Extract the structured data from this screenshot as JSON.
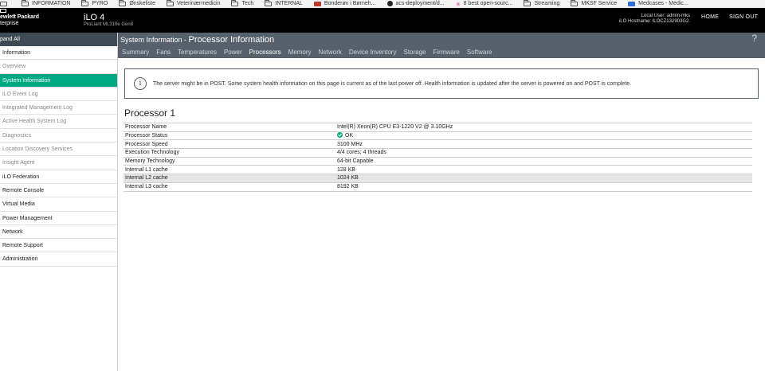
{
  "bookmarks": [
    {
      "label": "",
      "icon": "monitor-icon"
    },
    {
      "label": "INFORMATION",
      "icon": "folder-icon"
    },
    {
      "label": "PYRO",
      "icon": "folder-icon"
    },
    {
      "label": "Ønskeliste",
      "icon": "folder-icon"
    },
    {
      "label": "Veterinærmedicin",
      "icon": "folder-icon"
    },
    {
      "label": "Tech",
      "icon": "folder-icon"
    },
    {
      "label": "INTERNAL",
      "icon": "folder-icon"
    },
    {
      "label": "Bonderøv i Børneh...",
      "icon": "red-site-icon"
    },
    {
      "label": "acs-deployment/d...",
      "icon": "github-icon"
    },
    {
      "label": "8 best open-sourc...",
      "icon": "pink-site-icon"
    },
    {
      "label": "Streaming",
      "icon": "folder-icon"
    },
    {
      "label": "MKSF Service",
      "icon": "folder-icon"
    },
    {
      "label": "Medcases - Medic...",
      "icon": "blue-site-icon"
    }
  ],
  "header": {
    "brand_line1": "ewlett Packard",
    "brand_line2": "terprise",
    "product": "iLO 4",
    "model": "ProLiant ML310e Gen8",
    "local_user": "Local User: admin-mks",
    "hostname": "iLO Hostname: ILOCZ132903G2.",
    "home_label": "HOME",
    "signout_label": "SIGN OUT"
  },
  "sidebar": {
    "expand_label": "pand All",
    "items": [
      {
        "label": "Information",
        "type": "section"
      },
      {
        "label": "Overview",
        "type": "sub"
      },
      {
        "label": "System Information",
        "type": "active"
      },
      {
        "label": "iLO Event Log",
        "type": "sub"
      },
      {
        "label": "Integrated Management Log",
        "type": "sub"
      },
      {
        "label": "Active Health System Log",
        "type": "sub"
      },
      {
        "label": "Diagnostics",
        "type": "sub"
      },
      {
        "label": "Location Discovery Services",
        "type": "sub"
      },
      {
        "label": "Insight Agent",
        "type": "sub"
      },
      {
        "label": "iLO Federation",
        "type": "section"
      },
      {
        "label": "Remote Console",
        "type": "section"
      },
      {
        "label": "Virtual Media",
        "type": "section"
      },
      {
        "label": "Power Management",
        "type": "section"
      },
      {
        "label": "Network",
        "type": "section"
      },
      {
        "label": "Remote Support",
        "type": "section"
      },
      {
        "label": "Administration",
        "type": "section"
      }
    ]
  },
  "main": {
    "breadcrumb_prefix": "System Information - ",
    "breadcrumb_page": "Processor Information",
    "help_icon": "?",
    "tabs": [
      "Summary",
      "Fans",
      "Temperatures",
      "Power",
      "Processors",
      "Memory",
      "Network",
      "Device Inventory",
      "Storage",
      "Firmware",
      "Software"
    ],
    "active_tab": "Processors",
    "alert_text": "The server might be in POST. Some system health information on this page is current as of the last power off. Health information is updated after the server is powered on and POST is complete.",
    "processor_title": "Processor 1",
    "rows": [
      {
        "label": "Processor Name",
        "value": "Intel(R) Xeon(R) CPU E3-1220 V2 @ 3.10GHz"
      },
      {
        "label": "Processor Status",
        "value": "OK",
        "status": true
      },
      {
        "label": "Processor Speed",
        "value": "3100 MHz"
      },
      {
        "label": "Execution Technology",
        "value": "4/4 cores; 4 threads"
      },
      {
        "label": "Memory Technology",
        "value": "64-bit Capable"
      },
      {
        "label": "Internal L1 cache",
        "value": "128 KB"
      },
      {
        "label": "Internal L2 cache",
        "value": "1024 KB",
        "highlighted": true
      },
      {
        "label": "Internal L3 cache",
        "value": "8192 KB"
      }
    ]
  },
  "colors": {
    "accent": "#01a982",
    "header_bg": "#000000",
    "topbar_bg": "#56616c"
  }
}
